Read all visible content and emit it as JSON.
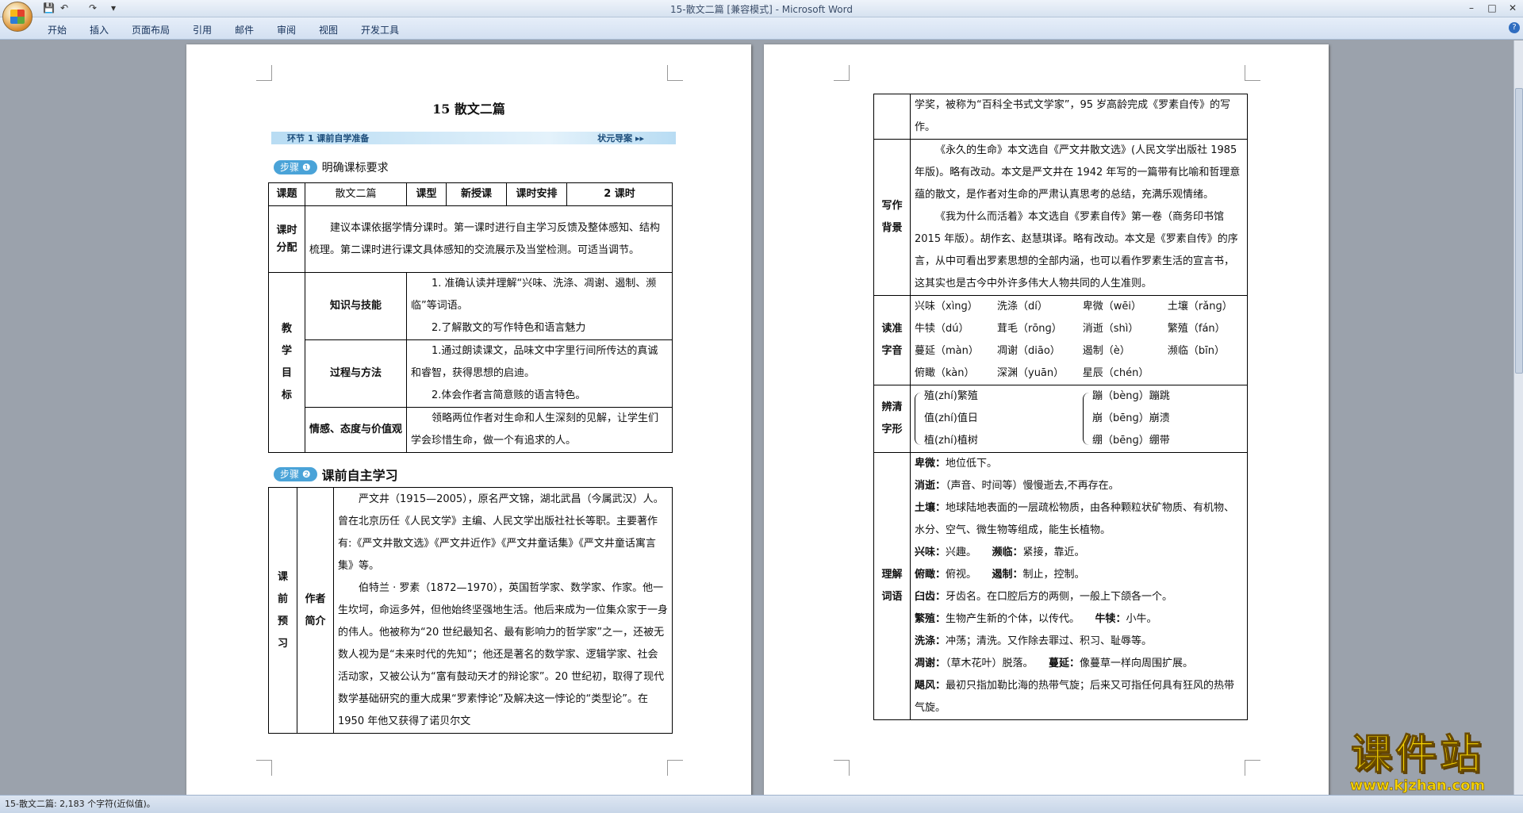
{
  "window": {
    "title": "15-散文二篇 [兼容模式] - Microsoft Word",
    "controls": [
      "–",
      "□",
      "✕"
    ]
  },
  "quick_access": [
    "💾",
    "↶",
    "↷",
    "▾"
  ],
  "ribbon": {
    "tabs": [
      "开始",
      "插入",
      "页面布局",
      "引用",
      "邮件",
      "审阅",
      "视图",
      "开发工具"
    ]
  },
  "status_bar": {
    "text": "15-散文二篇: 2,183 个字符(近似值)。"
  },
  "watermark": {
    "main": "课件站",
    "sub": "www.kjzhan.com"
  },
  "page1": {
    "heading": "15  散文二篇",
    "banner": {
      "left": "环节 1  课前自学准备",
      "right": "状元导案 ▸▸"
    },
    "step1": {
      "pill": "步骤 ❶",
      "title": "明确课标要求"
    },
    "table1": {
      "r1": {
        "c1": "课题",
        "c2": "散文二篇",
        "c3": "课型",
        "c4": "新授课",
        "c5": "课时安排",
        "c6": "2 课时"
      },
      "r2": {
        "label": "课时分配",
        "text": "建议本课依据学情分课时。第一课时进行自主学习反馈及整体感知、结构梳理。第二课时进行课文具体感知的交流展示及当堂检测。可适当调节。"
      },
      "goals_label": "教学目标",
      "g1": {
        "label": "知识与技能",
        "t1": "1. 准确认读并理解“兴味、洗涤、凋谢、遏制、濒临”等词语。",
        "t2": "2.了解散文的写作特色和语言魅力"
      },
      "g2": {
        "label": "过程与方法",
        "t1": "1.通过朗读课文，品味文中字里行间所传达的真诚和睿智，获得思想的启迪。",
        "t2": "2.体会作者言简意赅的语言特色。"
      },
      "g3": {
        "label": "情感、态度与价值观",
        "t1": "领略两位作者对生命和人生深刻的见解，让学生们学会珍惜生命，做一个有追求的人。"
      }
    },
    "step2": {
      "pill": "步骤 ❷",
      "title": "课前自主学习"
    },
    "table2": {
      "label1": "课前预习",
      "label2": "作者简介",
      "p1": "严文井（1915—2005），原名严文锦，湖北武昌（今属武汉）人。曾在北京历任《人民文学》主编、人民文学出版社社长等职。主要著作有:《严文井散文选》《严文井近作》《严文井童话集》《严文井童话寓言集》等。",
      "p2": "伯特兰 · 罗素（1872—1970），英国哲学家、数学家、作家。他一生坎坷，命运多舛，但他始终坚强地生活。他后来成为一位集众家于一身的伟人。他被称为“20 世纪最知名、最有影响力的哲学家”之一，还被无数人视为是“未来时代的先知”；他还是著名的数学家、逻辑学家、社会活动家，又被公认为“富有鼓动天才的辩论家”。20 世纪初，取得了现代数学基础研究的重大成果“罗素悖论”及解决这一悖论的“类型论”。在 1950 年他又获得了诺贝尔文"
    }
  },
  "page2": {
    "cont": "学奖，被称为“百科全书式文学家”，95 岁高龄完成《罗素自传》的写作。",
    "bg": {
      "label": "写作背景",
      "p1": "《永久的生命》本文选自《严文井散文选》(人民文学出版社 1985 年版)。略有改动。本文是严文井在 1942 年写的一篇带有比喻和哲理意蕴的散文，是作者对生命的严肃认真思考的总结，充满乐观情绪。",
      "p2": "《我为什么而活着》本文选自《罗素自传》第一卷（商务印书馆 2015 年版）。胡作玄、赵慧琪译。略有改动。本文是《罗素自传》的序言，从中可看出罗素思想的全部内涵，也可以看作罗素生活的宣言书，这其实也是古今中外许多伟大人物共同的人生准则。"
    },
    "pron": {
      "label": "读准字音",
      "rows": [
        [
          "兴味（xìnɡ）",
          "洗涤（dí）",
          "卑微（wēi）",
          "土壤（rǎnɡ）"
        ],
        [
          "牛犊（dú）",
          "茸毛（rōnɡ）",
          "消逝（shì）",
          "繁殖（fán）"
        ],
        [
          "蔓延（màn）",
          "凋谢（diāo）",
          "遏制（è）",
          "濒临（bīn）"
        ],
        [
          "俯瞰（kàn）",
          "深渊（yuān）",
          "星辰（chén）",
          ""
        ]
      ]
    },
    "distinguish": {
      "label": "辨清字形",
      "left": [
        "殖(zhí)繁殖",
        "值(zhí)值日",
        "植(zhí)植树"
      ],
      "right": [
        "蹦（bènɡ）蹦跳",
        "崩（bēnɡ）崩溃",
        "绷（bēnɡ）绷带"
      ]
    },
    "words": {
      "label": "理解词语",
      "lines": [
        "<b>卑微：</b>地位低下。",
        "<b>消逝：</b>（声音、时间等）慢慢逝去,不再存在。",
        "<b>土壤：</b>地球陆地表面的一层疏松物质，由各种颗粒状矿物质、有机物、水分、空气、微生物等组成，能生长植物。",
        "<b>兴味：</b>兴趣。　　<b>濒临：</b>紧接，靠近。",
        "<b>俯瞰：</b>俯视。　　<b>遏制：</b>制止，控制。",
        "<b>臼齿：</b>牙齿名。在口腔后方的两侧，一般上下颌各一个。",
        "<b>繁殖：</b>生物产生新的个体，以传代。　　<b>牛犊：</b>小牛。",
        "<b>洗涤：</b>冲荡；清洗。又作除去罪过、积习、耻辱等。",
        "<b>凋谢：</b>（草木花叶）脱落。　　<b>蔓延：</b>像蔓草一样向周围扩展。",
        "<b>飓风：</b>最初只指加勒比海的热带气旋；后来又可指任何具有狂风的热带气旋。"
      ]
    }
  }
}
